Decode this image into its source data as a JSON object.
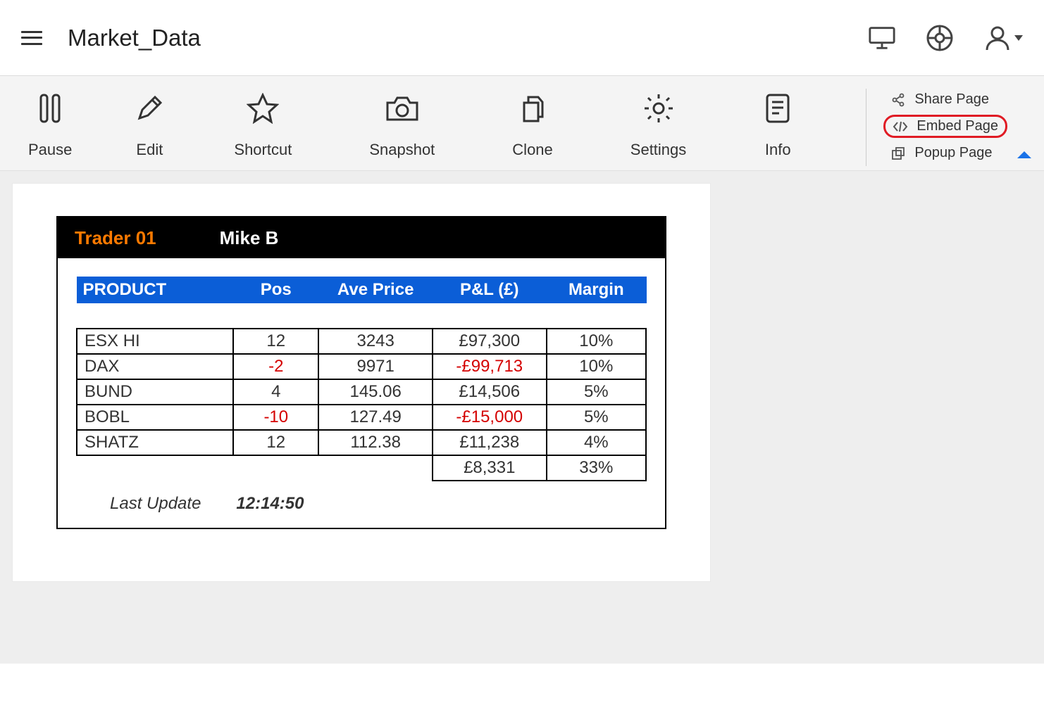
{
  "header": {
    "title": "Market_Data"
  },
  "toolbar": {
    "pause": "Pause",
    "edit": "Edit",
    "shortcut": "Shortcut",
    "snapshot": "Snapshot",
    "clone": "Clone",
    "settings": "Settings",
    "info": "Info"
  },
  "side_links": {
    "share": "Share Page",
    "embed": "Embed Page",
    "popup": "Popup Page"
  },
  "card": {
    "trader_label": "Trader 01",
    "trader_name": "Mike B",
    "columns": {
      "product": "PRODUCT",
      "pos": "Pos",
      "ave": "Ave Price",
      "pnl": "P&L (£)",
      "margin": "Margin"
    },
    "rows": [
      {
        "product": "ESX HI",
        "pos": "12",
        "pos_neg": false,
        "ave": "3243",
        "pnl": "£97,300",
        "pnl_neg": false,
        "margin": "10%"
      },
      {
        "product": "DAX",
        "pos": "-2",
        "pos_neg": true,
        "ave": "9971",
        "pnl": "-£99,713",
        "pnl_neg": true,
        "margin": "10%"
      },
      {
        "product": "BUND",
        "pos": "4",
        "pos_neg": false,
        "ave": "145.06",
        "pnl": "£14,506",
        "pnl_neg": false,
        "margin": "5%"
      },
      {
        "product": "BOBL",
        "pos": "-10",
        "pos_neg": true,
        "ave": "127.49",
        "pnl": "-£15,000",
        "pnl_neg": true,
        "margin": "5%"
      },
      {
        "product": "SHATZ",
        "pos": "12",
        "pos_neg": false,
        "ave": "112.38",
        "pnl": "£11,238",
        "pnl_neg": false,
        "margin": "4%"
      }
    ],
    "total": {
      "pnl": "£8,331",
      "margin": "33%"
    },
    "last_update_label": "Last Update",
    "last_update_value": "12:14:50"
  }
}
